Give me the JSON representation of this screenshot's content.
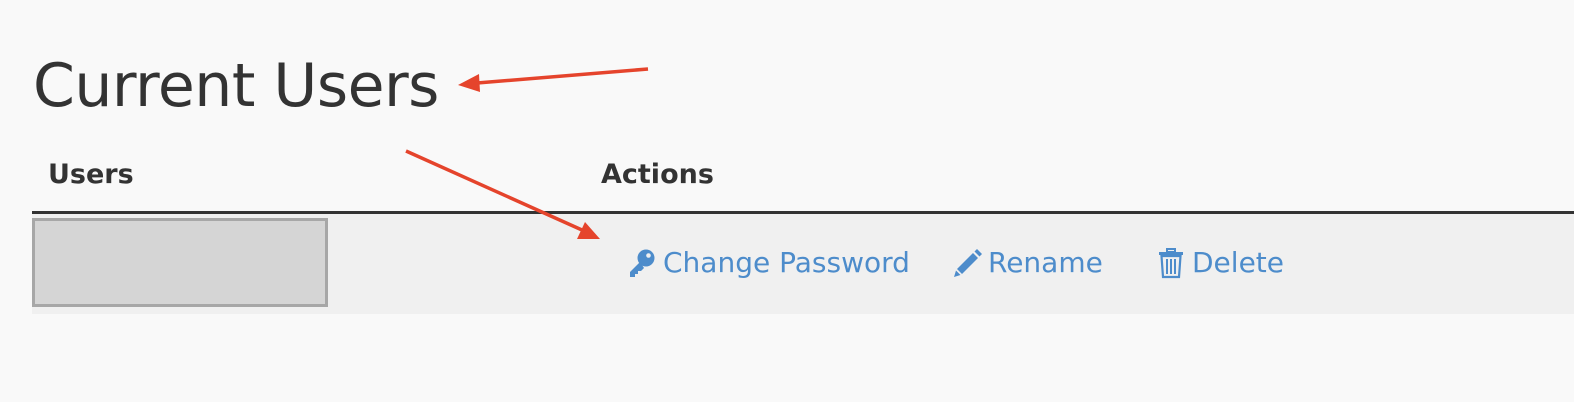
{
  "page": {
    "title": "Current Users"
  },
  "table": {
    "headers": {
      "users": "Users",
      "actions": "Actions"
    },
    "rows": [
      {
        "user": "",
        "actions": [
          {
            "label": "Change Password",
            "icon": "key-icon"
          },
          {
            "label": "Rename",
            "icon": "pencil-icon"
          },
          {
            "label": "Delete",
            "icon": "trash-icon"
          }
        ]
      }
    ]
  },
  "colors": {
    "background": "#f9f9f9",
    "text": "#333333",
    "row_background": "#f0f0f0",
    "link": "#4d8ccb",
    "redacted_fill": "#d5d5d5",
    "annotation_arrow": "#e5442c"
  }
}
